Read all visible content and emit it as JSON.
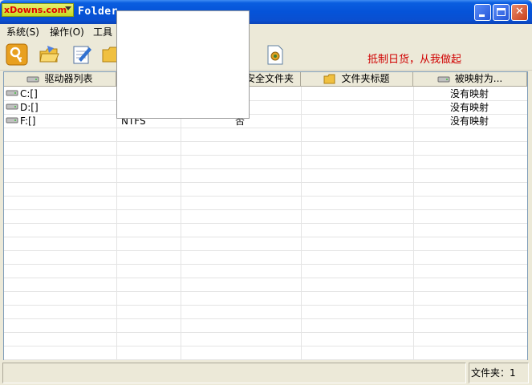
{
  "window": {
    "logo_text": "xDowns.com",
    "title": "Folder"
  },
  "menu": {
    "items": [
      {
        "label": "系统(S)"
      },
      {
        "label": "操作(O)"
      },
      {
        "label": "工具"
      }
    ]
  },
  "toolbar": {
    "slogan": "抵制日货，从我做起"
  },
  "table": {
    "columns": [
      {
        "label": "驱动器列表",
        "icon": "drive-icon"
      },
      {
        "label": "",
        "icon": ""
      },
      {
        "label": "",
        "icon": ""
      },
      {
        "label": "安全文件夹",
        "icon": ""
      },
      {
        "label": "文件夹标题",
        "icon": "folder-icon"
      },
      {
        "label": "被映射为...",
        "icon": "drive-icon"
      }
    ],
    "rows": [
      {
        "drive": "C:[]",
        "fs": "",
        "secure": "",
        "title": "",
        "mapped": "没有映射"
      },
      {
        "drive": "D:[]",
        "fs": "",
        "secure": "",
        "title": "",
        "mapped": "没有映射"
      },
      {
        "drive": "F:[]",
        "fs": "NTFS",
        "secure": "否",
        "title": "",
        "mapped": "没有映射"
      }
    ]
  },
  "status": {
    "folder_count": "文件夹：1"
  }
}
